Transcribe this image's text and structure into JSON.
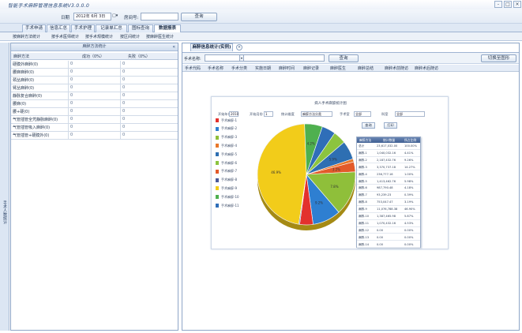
{
  "app": {
    "title": "智能手术麻醉管理信息系统V3.0.0.0",
    "window_controls": [
      "-",
      "□",
      "×"
    ]
  },
  "query": {
    "date_label": "日期",
    "date_value": "2012年 6月 3日",
    "date_picker": "□▾",
    "room_label": "房间号:",
    "room_value": "",
    "query_button": "查询"
  },
  "main_tabs": [
    {
      "label": "手术申请",
      "active": false
    },
    {
      "label": "信息汇总",
      "active": false
    },
    {
      "label": "手术护理",
      "active": false
    },
    {
      "label": "记录单汇总",
      "active": false
    },
    {
      "label": "图标查询",
      "active": false
    },
    {
      "label": "数据报表",
      "active": true
    }
  ],
  "sub_tabs": [
    "按麻醉方法统计",
    "按手术医师统计",
    "按手术规模统计",
    "按区间统计",
    "按麻醉医生统计"
  ],
  "left_strip": "手术人数统计",
  "left_panel": {
    "header": "麻醉方法统计",
    "collapse": "«",
    "columns": [
      "麻醉方法",
      "成功（0%）",
      "失败（0%）"
    ],
    "rows": [
      {
        "name": "硬膜外麻醉(0)",
        "success": "0",
        "fail": "0"
      },
      {
        "name": "腰麻麻醉(0)",
        "success": "0",
        "fail": "0"
      },
      {
        "name": "颈丛麻醉(0)",
        "success": "0",
        "fail": "0"
      },
      {
        "name": "臂丛麻醉(0)",
        "success": "0",
        "fail": "0"
      },
      {
        "name": "静脉复合麻醉(0)",
        "success": "0",
        "fail": "0"
      },
      {
        "name": "腰麻(0)",
        "success": "0",
        "fail": "0"
      },
      {
        "name": "腰+硬(0)",
        "success": "0",
        "fail": "0"
      },
      {
        "name": "气管插管全凭静脉麻醉(0)",
        "success": "0",
        "fail": "0"
      },
      {
        "name": "气管插管吸入麻醉(0)",
        "success": "0",
        "fail": "0"
      },
      {
        "name": "气管插管+硬膜外(0)",
        "success": "0",
        "fail": "0"
      }
    ]
  },
  "right_panel": {
    "tab_label": "麻醉信息统计(实例)",
    "tab_close": "×",
    "name_label": "手术名称:",
    "name_value": "",
    "search_button": "查询",
    "switch_button": "切换至图形",
    "columns": [
      "手术代码",
      "手术名称",
      "手术分类",
      "实施日期",
      "麻醉时间",
      "麻醉记录",
      "麻醉医生",
      "麻醉总结",
      "麻醉术前随访",
      "麻醉术后随访"
    ]
  },
  "report": {
    "title": "病人手术麻醉统计图",
    "filters": [
      {
        "label": "开始年份",
        "value": "2010"
      },
      {
        "label": "开始月份",
        "value": "1"
      },
      {
        "label": "统计维度",
        "value": "麻醉方法分类"
      },
      {
        "label": "手术室",
        "value": "全部"
      },
      {
        "label": "科室",
        "value": "全部"
      }
    ],
    "query_button": "查询",
    "print_button": "打印",
    "legend": [
      {
        "label": "手术麻醉-1",
        "color": "#e3312d"
      },
      {
        "label": "手术麻醉-2",
        "color": "#2e7fd1"
      },
      {
        "label": "手术麻醉-3",
        "color": "#8fbf3a"
      },
      {
        "label": "手术麻醉-4",
        "color": "#e8772a"
      },
      {
        "label": "手术麻醉-5",
        "color": "#2e6fb2"
      },
      {
        "label": "手术麻醉-6",
        "color": "#8cc43f"
      },
      {
        "label": "手术麻醉-7",
        "color": "#e35a2a"
      },
      {
        "label": "手术麻醉-8",
        "color": "#4a5a9a"
      },
      {
        "label": "手术麻醉-9",
        "color": "#f2cc1a"
      },
      {
        "label": "手术麻醉-10",
        "color": "#4fb04f"
      },
      {
        "label": "手术麻醉-11",
        "color": "#2f6eb8"
      }
    ],
    "pie_labels": [
      "46.9%",
      "9.2%",
      "4.2%",
      "7.8%",
      "5.9%",
      "3.2%"
    ],
    "stats_columns": [
      "麻醉方法",
      "统计数量",
      "所占比例"
    ],
    "stats_rows": [
      {
        "name": "总计",
        "count": "23,617,032.00",
        "pct": "100.00%"
      },
      {
        "name": "麻醉-1",
        "count": "1,040,032.16",
        "pct": "4.41%"
      },
      {
        "name": "麻醉-2",
        "count": "2,187,432.76",
        "pct": "9.26%"
      },
      {
        "name": "麻醉-3",
        "count": "3,370,737.18",
        "pct": "14.27%"
      },
      {
        "name": "麻醉-4",
        "count": "236,777.16",
        "pct": "1.00%"
      },
      {
        "name": "麻醉-5",
        "count": "1,413,462.76",
        "pct": "5.98%"
      },
      {
        "name": "麻醉-6",
        "count": "987,790.48",
        "pct": "4.18%"
      },
      {
        "name": "麻醉-7",
        "count": "93,239.23",
        "pct": "0.39%"
      },
      {
        "name": "麻醉-8",
        "count": "753,047.47",
        "pct": "3.19%"
      },
      {
        "name": "麻醉-9",
        "count": "11,076,788.38",
        "pct": "46.90%"
      },
      {
        "name": "麻醉-10",
        "count": "1,387,465.98",
        "pct": "5.87%"
      },
      {
        "name": "麻醉-11",
        "count": "1,070,432.16",
        "pct": "4.53%"
      },
      {
        "name": "麻醉-12",
        "count": "0.00",
        "pct": "0.00%"
      },
      {
        "name": "麻醉-13",
        "count": "0.00",
        "pct": "0.00%"
      },
      {
        "name": "麻醉-14",
        "count": "0.00",
        "pct": "0.00%"
      }
    ],
    "chart_data": {
      "type": "pie",
      "slices": [
        {
          "name": "手术麻醉-9",
          "value": 46.9,
          "color": "#f2cc1a"
        },
        {
          "name": "手术麻醉-10",
          "value": 5.9,
          "color": "#4fb04f"
        },
        {
          "name": "手术麻醉-11",
          "value": 4.5,
          "color": "#2f6eb8"
        },
        {
          "name": "手术麻醉-6",
          "value": 4.2,
          "color": "#8cc43f"
        },
        {
          "name": "手术麻醉-5",
          "value": 6.0,
          "color": "#2e6fb2"
        },
        {
          "name": "手术麻醉-4",
          "value": 1.0,
          "color": "#e8772a"
        },
        {
          "name": "手术麻醉-7",
          "value": 3.2,
          "color": "#e35a2a"
        },
        {
          "name": "手术麻醉-3",
          "value": 14.3,
          "color": "#8fbf3a"
        },
        {
          "name": "手术麻醉-2",
          "value": 9.3,
          "color": "#2e7fd1"
        },
        {
          "name": "手术麻醉-1",
          "value": 4.4,
          "color": "#e3312d"
        },
        {
          "name": "手术麻醉-8",
          "value": 0.3,
          "color": "#4a5a9a"
        }
      ]
    }
  }
}
